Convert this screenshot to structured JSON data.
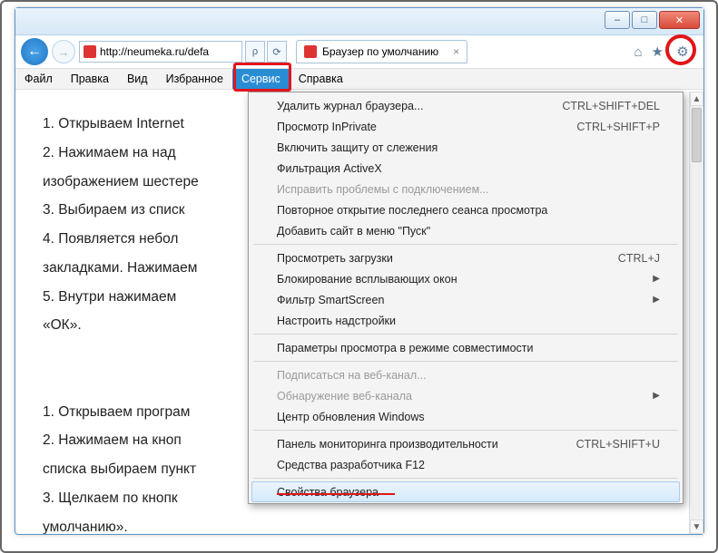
{
  "window": {
    "minimize": "–",
    "maximize": "□",
    "close": "✕"
  },
  "nav": {
    "back": "←",
    "forward": "→",
    "url": "http://neumeka.ru/defa",
    "search_hint": "ρ",
    "refresh": "⟳"
  },
  "tab": {
    "title": "Браузер по умолчанию",
    "close": "×"
  },
  "toolbar_icons": {
    "home": "⌂",
    "star": "★",
    "gear": "⚙"
  },
  "menubar": {
    "items": [
      "Файл",
      "Правка",
      "Вид",
      "Избранное",
      "Сервис",
      "Справка"
    ],
    "active_index": 4
  },
  "dropdown": {
    "items": [
      {
        "label": "Удалить журнал браузера...",
        "shortcut": "CTRL+SHIFT+DEL"
      },
      {
        "label": "Просмотр InPrivate",
        "shortcut": "CTRL+SHIFT+P"
      },
      {
        "label": "Включить защиту от слежения"
      },
      {
        "label": "Фильтрация ActiveX"
      },
      {
        "label": "Исправить проблемы с подключением...",
        "disabled": true
      },
      {
        "label": "Повторное открытие последнего сеанса просмотра"
      },
      {
        "label": "Добавить сайт в меню \"Пуск\""
      },
      {
        "sep": true
      },
      {
        "label": "Просмотреть загрузки",
        "shortcut": "CTRL+J"
      },
      {
        "label": "Блокирование всплывающих окон",
        "submenu": true
      },
      {
        "label": "Фильтр SmartScreen",
        "submenu": true
      },
      {
        "label": "Настроить надстройки"
      },
      {
        "sep": true
      },
      {
        "label": "Параметры просмотра в режиме совместимости"
      },
      {
        "sep": true
      },
      {
        "label": "Подписаться на веб-канал...",
        "disabled": true
      },
      {
        "label": "Обнаружение веб-канала",
        "disabled": true,
        "submenu": true
      },
      {
        "label": "Центр обновления Windows"
      },
      {
        "sep": true
      },
      {
        "label": "Панель мониторинга производительности",
        "shortcut": "CTRL+SHIFT+U"
      },
      {
        "label": "Средства разработчика F12"
      },
      {
        "sep": true
      },
      {
        "label": "Свойства браузера",
        "hover": true,
        "underline": true
      }
    ]
  },
  "page": {
    "lines": [
      "1.   Открываем Internet",
      "2.  Нажимаем  на  над",
      "изображением шестере",
      "3.   Выбираем из списк",
      "4.  Появляется  небол",
      "закладками. Нажимаем",
      "5.  Внутри  нажимаем",
      "«ОК».",
      "",
      "",
      "1.   Открываем програм",
      "2.  Нажимаем  на  кноп",
      "списка выбираем пункт",
      "3.  Щелкаем  по  кнопк",
      "умолчанию»."
    ]
  }
}
